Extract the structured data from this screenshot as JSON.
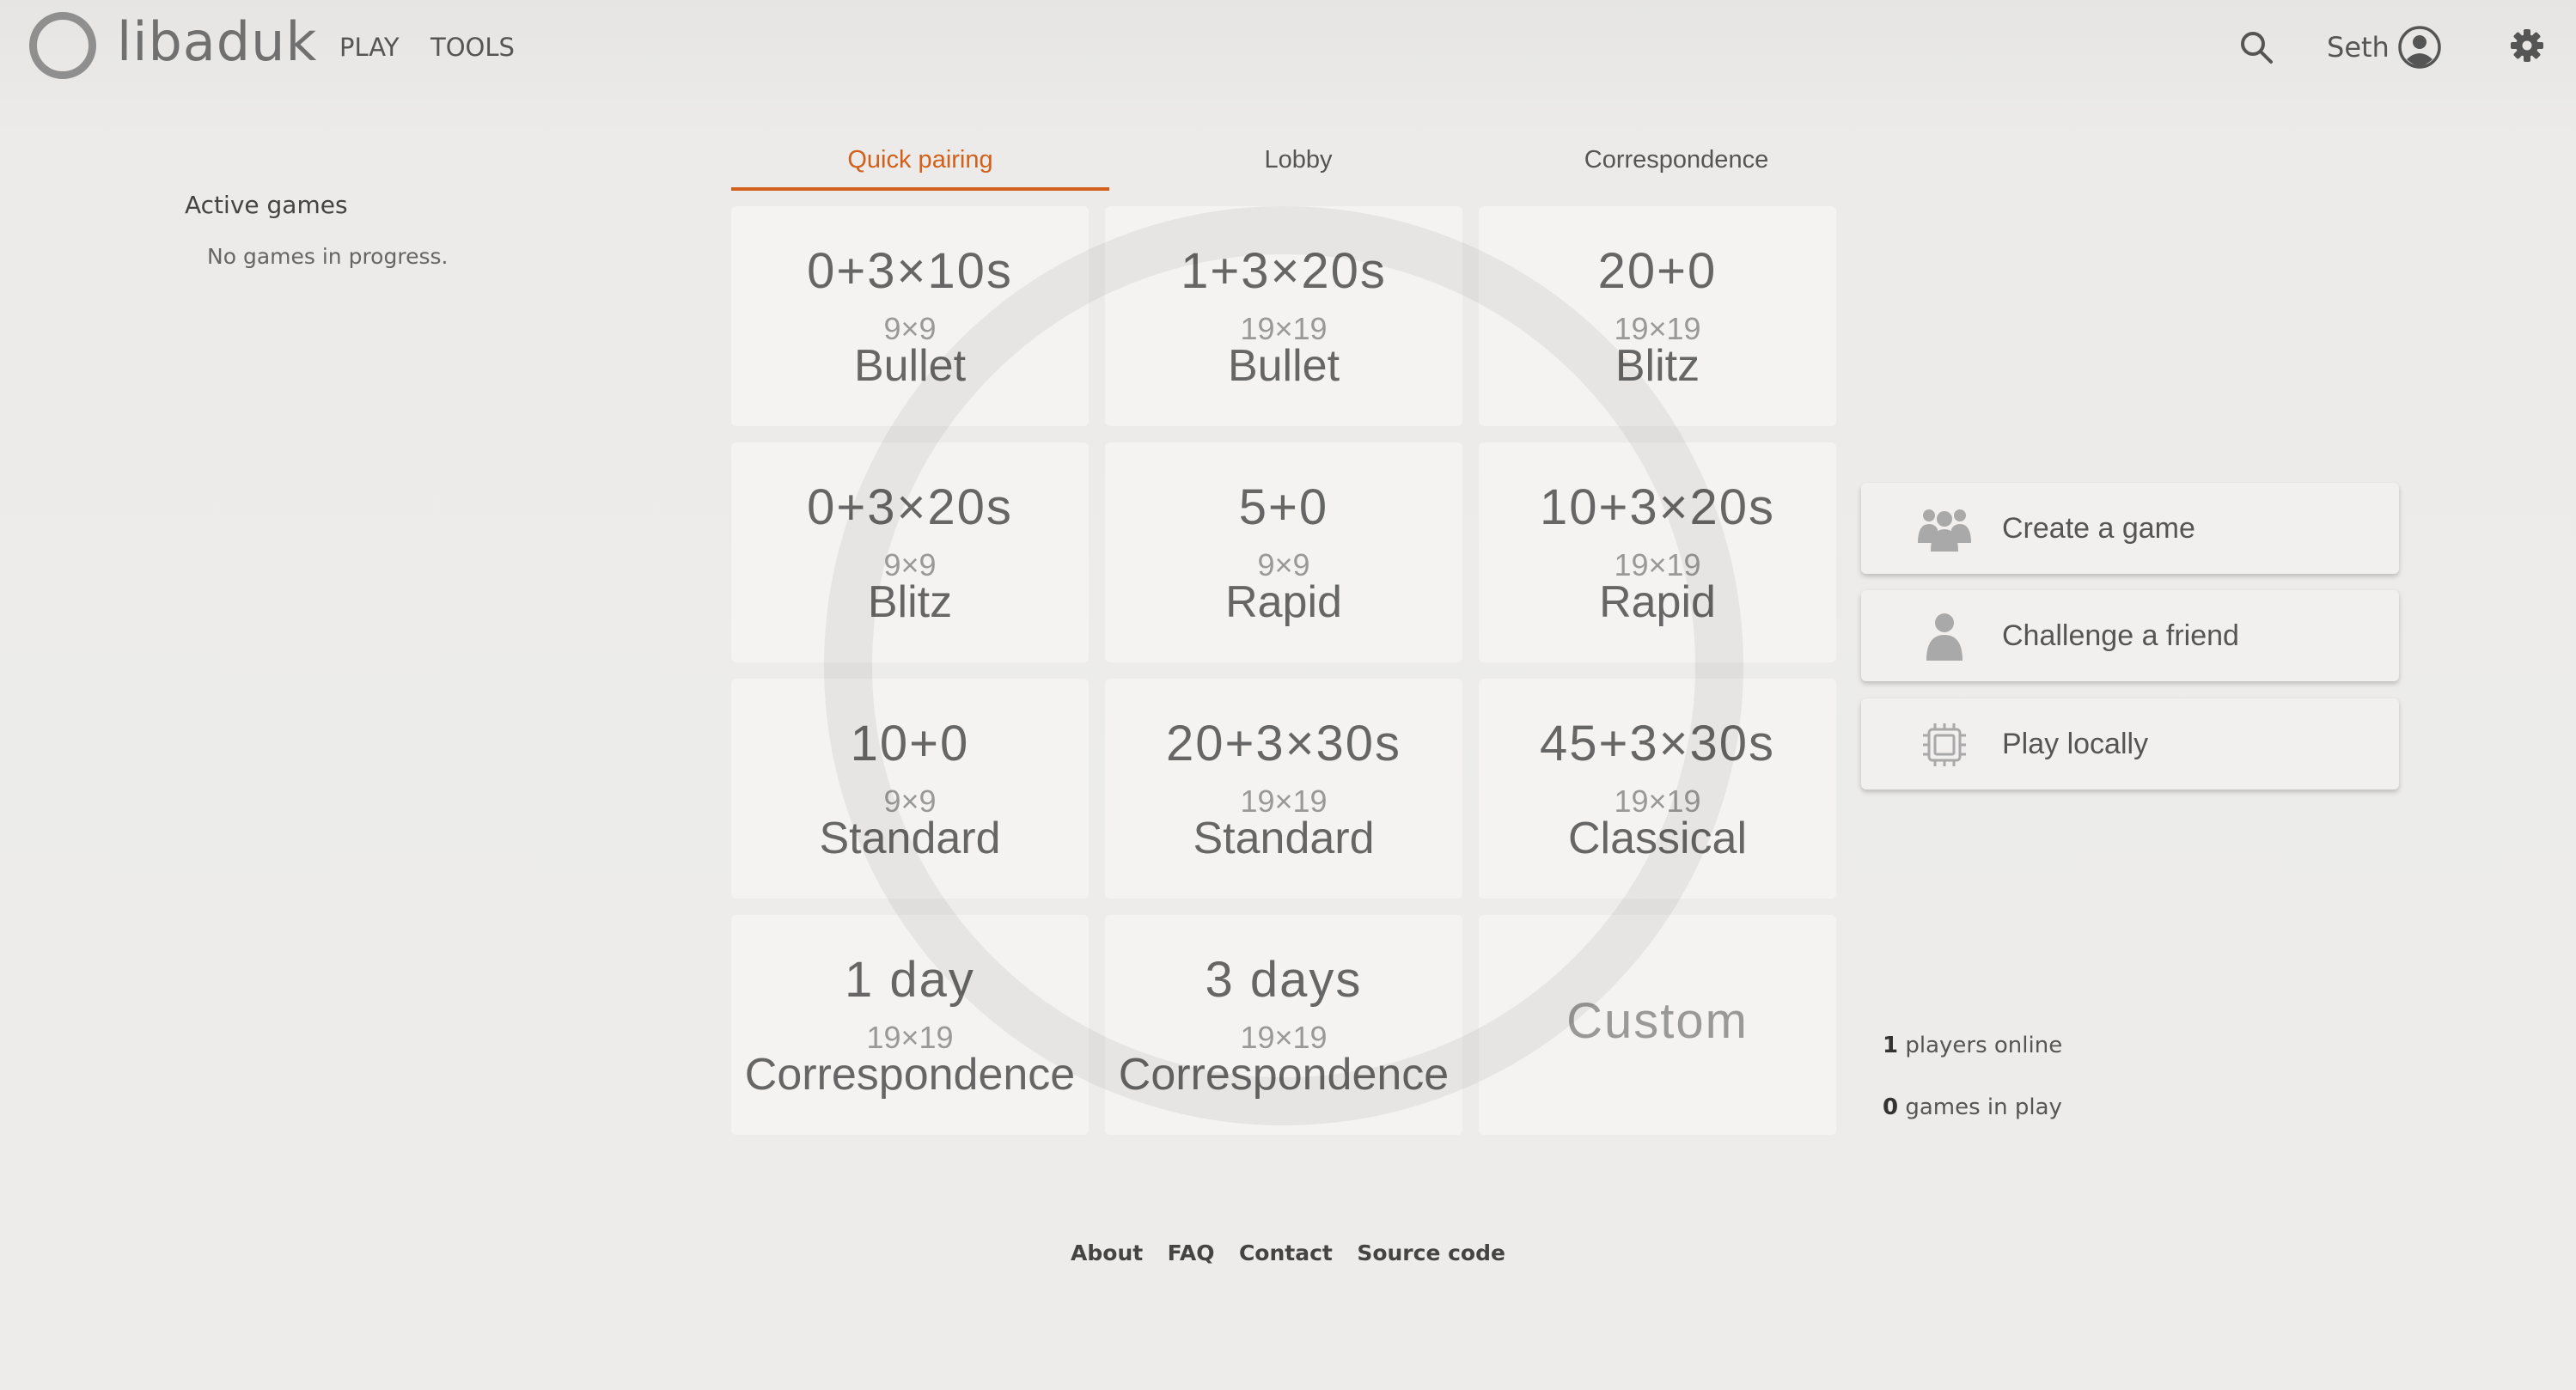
{
  "header": {
    "logo_text": "libaduk",
    "nav": [
      "PLAY",
      "TOOLS"
    ],
    "user_name": "Seth",
    "icons": [
      "search-icon",
      "avatar-icon",
      "gear-icon"
    ]
  },
  "sidebar": {
    "title": "Active games",
    "empty_text": "No games in progress."
  },
  "tabs": [
    {
      "label": "Quick pairing",
      "active": true
    },
    {
      "label": "Lobby",
      "active": false
    },
    {
      "label": "Correspondence",
      "active": false
    }
  ],
  "accent_color": "#d2601a",
  "pairings": [
    {
      "time": "0+3×10s",
      "size": "9×9",
      "kind": "Bullet"
    },
    {
      "time": "1+3×20s",
      "size": "19×19",
      "kind": "Bullet"
    },
    {
      "time": "20+0",
      "size": "19×19",
      "kind": "Blitz"
    },
    {
      "time": "0+3×20s",
      "size": "9×9",
      "kind": "Blitz"
    },
    {
      "time": "5+0",
      "size": "9×9",
      "kind": "Rapid"
    },
    {
      "time": "10+3×20s",
      "size": "19×19",
      "kind": "Rapid"
    },
    {
      "time": "10+0",
      "size": "9×9",
      "kind": "Standard"
    },
    {
      "time": "20+3×30s",
      "size": "19×19",
      "kind": "Standard"
    },
    {
      "time": "45+3×30s",
      "size": "19×19",
      "kind": "Classical"
    },
    {
      "time": "1 day",
      "size": "19×19",
      "kind": "Correspondence"
    },
    {
      "time": "3 days",
      "size": "19×19",
      "kind": "Correspondence"
    }
  ],
  "custom_label": "Custom",
  "actions": [
    {
      "label": "Create a game",
      "icon": "group-icon"
    },
    {
      "label": "Challenge a friend",
      "icon": "person-icon"
    },
    {
      "label": "Play locally",
      "icon": "chip-icon"
    }
  ],
  "stats": {
    "players_count": "1",
    "players_label": " players online",
    "games_count": "0",
    "games_label": " games in play"
  },
  "footer": [
    "About",
    "FAQ",
    "Contact",
    "Source code"
  ]
}
